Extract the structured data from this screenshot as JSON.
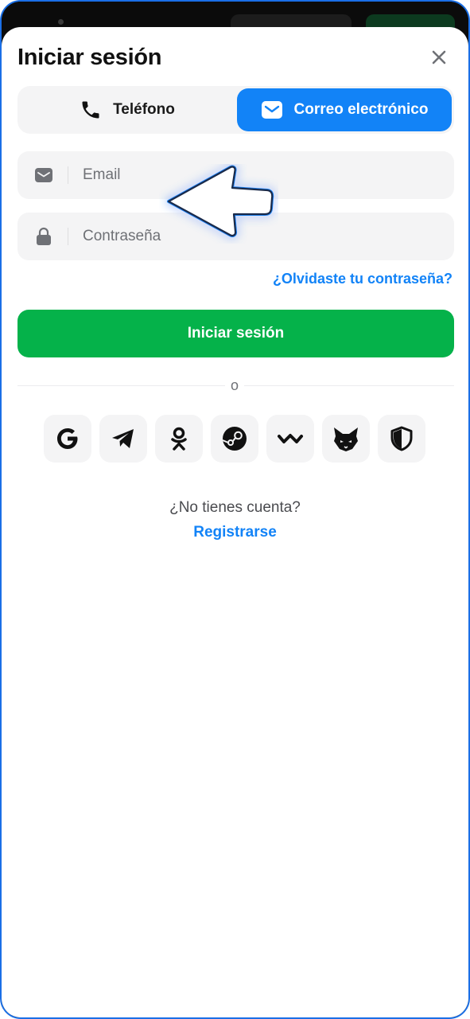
{
  "header": {
    "title": "Iniciar sesión",
    "close_icon": "close-icon"
  },
  "tabs": [
    {
      "label": "Teléfono",
      "icon": "phone-icon",
      "active": false
    },
    {
      "label": "Correo electrónico",
      "icon": "mail-icon",
      "active": true
    }
  ],
  "form": {
    "email": {
      "placeholder": "Email",
      "value": "",
      "icon": "mail-icon"
    },
    "password": {
      "placeholder": "Contraseña",
      "value": "",
      "icon": "lock-icon"
    },
    "forgot_label": "¿Olvidaste tu contraseña?",
    "submit_label": "Iniciar sesión"
  },
  "divider_label": "o",
  "social_logins": [
    {
      "name": "google",
      "icon": "google-icon"
    },
    {
      "name": "telegram",
      "icon": "telegram-icon"
    },
    {
      "name": "odnoklassniki",
      "icon": "odnoklassniki-icon"
    },
    {
      "name": "steam",
      "icon": "steam-icon"
    },
    {
      "name": "walletconnect",
      "icon": "walletconnect-icon"
    },
    {
      "name": "metamask",
      "icon": "metamask-fox-icon"
    },
    {
      "name": "shield",
      "icon": "shield-icon"
    }
  ],
  "footer": {
    "no_account_text": "¿No tienes cuenta?",
    "register_label": "Registrarse"
  },
  "colors": {
    "accent": "#1283f7",
    "primary_button": "#05b24a",
    "field_bg": "#f4f4f5",
    "frame_border": "#1a6fe6"
  }
}
